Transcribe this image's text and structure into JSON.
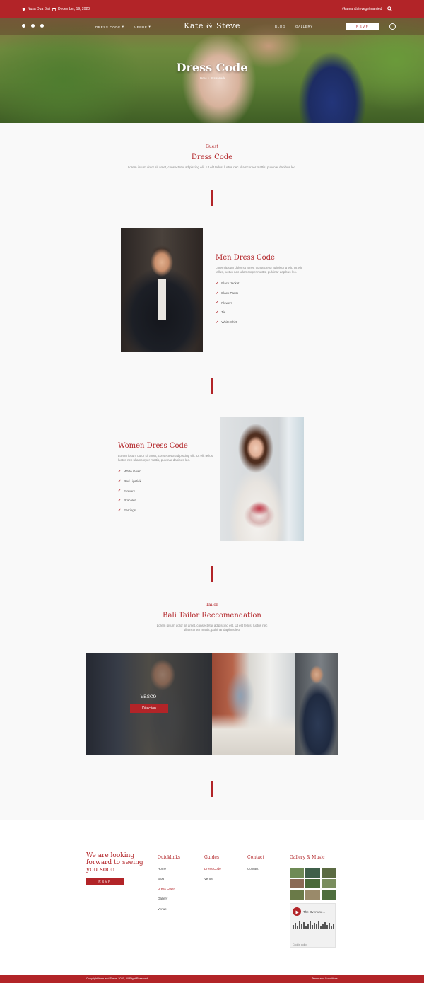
{
  "colors": {
    "accent": "#b22428",
    "bg": "#f9f9f9"
  },
  "topbar": {
    "location": "Nusa Dua Bali",
    "date": "December, 19, 2020",
    "hashtag": "#kateandstevegetmarried"
  },
  "nav": {
    "dress_code": "DRESS CODE",
    "venue": "VENUE",
    "logo": "Kate & Steve",
    "blog": "BLOG",
    "gallery": "GALLERY",
    "rsvp": "RSVP"
  },
  "hero": {
    "title": "Dress Code",
    "breadcrumb": "Home » Dresscode"
  },
  "intro": {
    "eyebrow": "Guest",
    "title": "Dress Code",
    "text": "Lorem ipsum dolor sit amet, consectetur adipiscing elit. Ut elit tellus, luctus nec ullamcorper mattis, pulvinar dapibus leo."
  },
  "men": {
    "title": "Men Dress Code",
    "text": "Lorem ipsum dolor sit amet, consectetur adipiscing elit. Ut elit tellus, luctus nec ullamcorper mattis, pulvinar dapibus leo.",
    "items": [
      "Black Jacket",
      "Black Pants",
      "Flowers",
      "Tie",
      "White Shirt"
    ]
  },
  "women": {
    "title": "Women Dress Code",
    "text": "Lorem ipsum dolor sit amet, consectetur adipiscing elit. Ut elit tellus, luctus nec ullamcorper mattis, pulvinar dapibus leo.",
    "items": [
      "White Gown",
      "Red Lipstick",
      "Flowers",
      "Bracelet",
      "Earrings"
    ]
  },
  "tailor": {
    "eyebrow": "Tailor",
    "title": "Bali Tailor Reccomendation",
    "text": "Lorem ipsum dolor sit amet, consectetur adipiscing elit. Ut elit tellus, luctus nec ullamcorper mattis, pulvinar dapibus leo.",
    "name": "Vasco",
    "button": "Direction"
  },
  "footer": {
    "cta": "We are looking forward to seeing you soon",
    "rsvp": "RSVP",
    "quicklinks": {
      "title": "Quicklinks",
      "items": [
        "Home",
        "Blog",
        "Dress Code",
        "Gallery",
        "Venue"
      ]
    },
    "guides": {
      "title": "Guides",
      "items": [
        "Dress Code",
        "Venue"
      ]
    },
    "contact": {
      "title": "Contact",
      "items": [
        "Contact"
      ]
    },
    "gallery": {
      "title": "Gallery & Music"
    },
    "player": {
      "track": "The Overtune...",
      "label": "Cookie policy"
    },
    "copyright": "Copyright Kate and Steve, 2020, All Right Reserved",
    "terms": "Terms and Conditions"
  }
}
